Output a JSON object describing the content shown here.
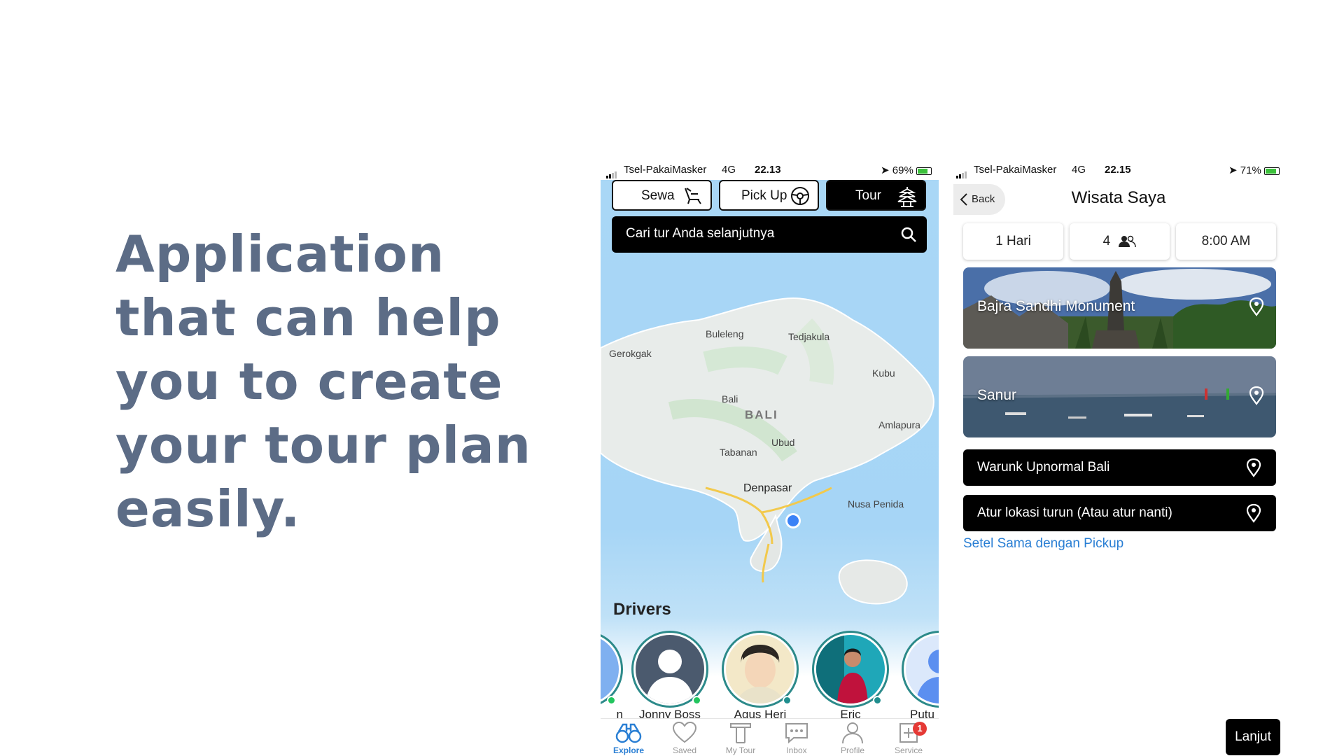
{
  "headline": "Application that can help you to create your tour plan easily.",
  "phone1": {
    "status": {
      "carrier": "Tsel-PakaiMasker",
      "network": "4G",
      "time": "22.13",
      "battery": "69%"
    },
    "modes": [
      {
        "label": "Sewa",
        "icon": "car-seat-icon",
        "active": false
      },
      {
        "label": "Pick Up",
        "icon": "steering-wheel-icon",
        "active": false
      },
      {
        "label": "Tour",
        "icon": "temple-icon",
        "active": true
      }
    ],
    "search": {
      "placeholder": "Cari tur Anda selanjutnya"
    },
    "map_labels": {
      "buleleng": "Buleleng",
      "tedjakula": "Tedjakula",
      "gerokgak": "Gerokgak",
      "kubu": "Kubu",
      "bali_small": "Bali",
      "bali": "BALI",
      "amlapura": "Amlapura",
      "ubud": "Ubud",
      "tabanan": "Tabanan",
      "denpasar": "Denpasar",
      "nusa_penida": "Nusa Penida"
    },
    "drivers_title": "Drivers",
    "drivers": [
      {
        "name": "n",
        "online": true
      },
      {
        "name": "Jonny Boss",
        "online": true
      },
      {
        "name": "Agus Heri",
        "online": false
      },
      {
        "name": "Eric",
        "online": false
      },
      {
        "name": "Putu",
        "online": false
      }
    ],
    "tabs": [
      {
        "label": "Explore",
        "icon": "binoculars-icon",
        "active": true
      },
      {
        "label": "Saved",
        "icon": "heart-icon",
        "active": false
      },
      {
        "label": "My Tour",
        "icon": "tour-icon",
        "active": false
      },
      {
        "label": "Inbox",
        "icon": "chat-icon",
        "active": false
      },
      {
        "label": "Profile",
        "icon": "person-icon",
        "active": false
      },
      {
        "label": "Service",
        "icon": "plus-box-icon",
        "active": false,
        "badge": "1"
      }
    ]
  },
  "phone2": {
    "status": {
      "carrier": "Tsel-PakaiMasker",
      "network": "4G",
      "time": "22.15",
      "battery": "71%"
    },
    "back_label": "Back",
    "title": "Wisata Saya",
    "pills": {
      "days": "1 Hari",
      "people": "4",
      "time": "8:00 AM"
    },
    "places": [
      "Bajra Sandhi Monument",
      "Sanur"
    ],
    "locations": [
      "Warunk Upnormal Bali",
      "Atur lokasi turun (Atau atur nanti)"
    ],
    "link": "Setel Sama dengan Pickup",
    "next_label": "Lanjut"
  },
  "colors": {
    "headline": "#5c6c86",
    "accent": "#2a7fd4",
    "online": "#22c55e",
    "badge": "#e53935"
  }
}
